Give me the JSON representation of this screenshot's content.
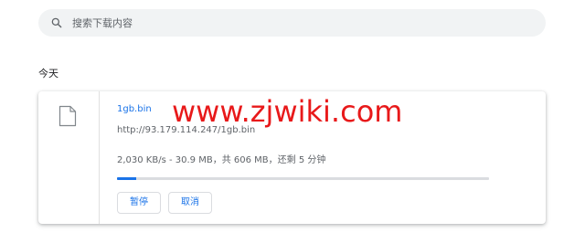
{
  "search": {
    "placeholder": "搜索下载内容",
    "icon": "search-icon"
  },
  "date_group": {
    "label": "今天"
  },
  "download": {
    "file_name": "1gb.bin",
    "url": "http://93.179.114.247/1gb.bin",
    "status": "2,030 KB/s - 30.9 MB，共 606 MB，还剩 5 分钟",
    "progress_fraction": 0.051,
    "icon": "file-icon",
    "actions": {
      "pause_label": "暂停",
      "cancel_label": "取消"
    }
  },
  "watermark": {
    "text": "www.zjwiki.com",
    "color": "#e8191a"
  },
  "colors": {
    "accent": "#1a73e8",
    "search_bg": "#f1f3f4",
    "secondary_text": "#5f6368"
  }
}
